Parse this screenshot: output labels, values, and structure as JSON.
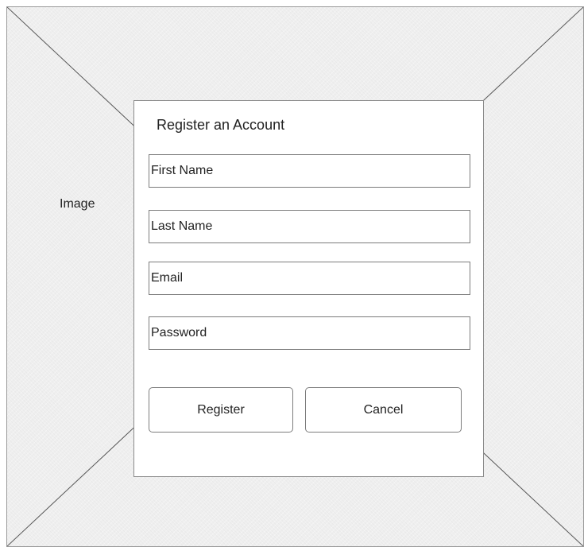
{
  "image_placeholder": {
    "label": "Image"
  },
  "dialog": {
    "title": "Register an Account",
    "fields": {
      "first_name": "First Name",
      "last_name": "Last Name",
      "email": "Email",
      "password": "Password"
    },
    "buttons": {
      "register": "Register",
      "cancel": "Cancel"
    }
  }
}
